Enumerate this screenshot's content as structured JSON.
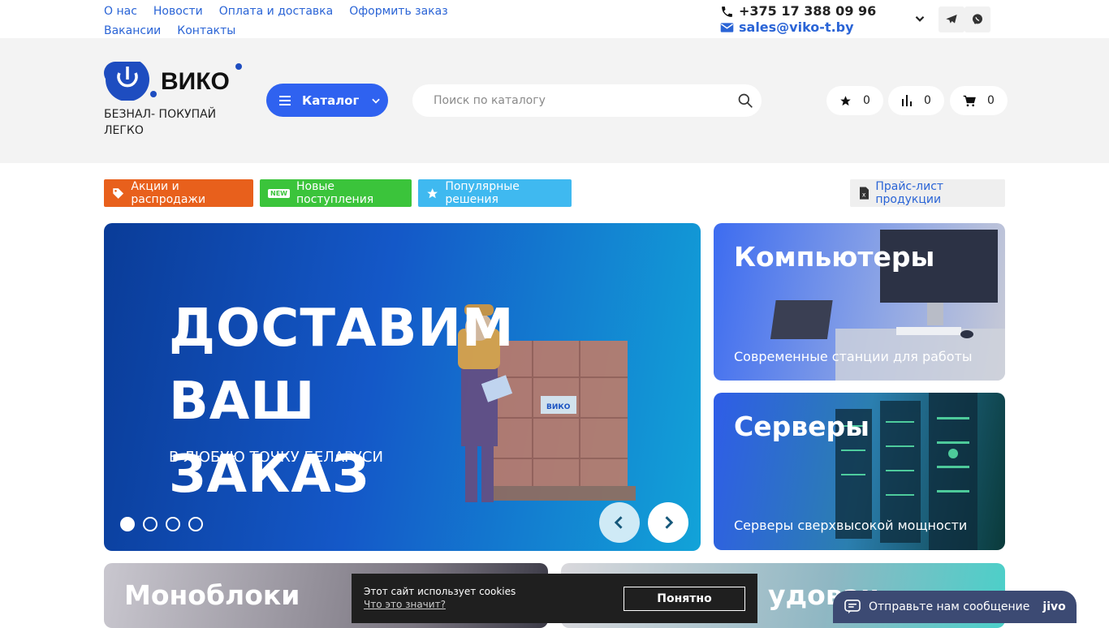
{
  "top_nav": {
    "row1": [
      "О нас",
      "Новости",
      "Оплата и доставка",
      "Оформить заказ"
    ],
    "row2": [
      "Вакансии",
      "Контакты"
    ]
  },
  "contacts": {
    "phone": "+375 17 388 09 96",
    "email": "sales@viko-t.by"
  },
  "logo": {
    "text": "ВИКО"
  },
  "tagline": "БЕЗНАЛ- ПОКУПАЙ ЛЕГКО",
  "catalog_label": "Каталог",
  "search": {
    "placeholder": "Поиск по каталогу"
  },
  "counters": {
    "favorites": "0",
    "compare": "0",
    "cart": "0"
  },
  "tags": {
    "sale": "Акции и распродажи",
    "new": "Новые поступления",
    "new_badge": "NEW",
    "popular": "Популярные решения",
    "price_list": "Прайс-лист продукции"
  },
  "slider": {
    "title_line1": "ДОСТАВИМ ВАШ",
    "title_line2": "ЗАКАЗ",
    "subtitle": "В ЛЮБУЮ ТОЧКУ БЕЛАРУСИ",
    "box_logo": "ВИКО",
    "slides_count": 4,
    "active_slide": 1
  },
  "cards": [
    {
      "title": "Компьютеры",
      "desc": "Современные станции для работы"
    },
    {
      "title": "Серверы",
      "desc": "Серверы сверхвысокой мощности"
    },
    {
      "title": "Моноблоки",
      "desc": ""
    },
    {
      "title": "удован",
      "desc": ""
    }
  ],
  "cookie": {
    "text": "Этот сайт использует cookies",
    "link": "Что это значит?",
    "button": "Понятно"
  },
  "chat": {
    "label": "Отправьте нам сообщение",
    "brand": "jivo"
  },
  "colors": {
    "accent": "#2f62f0",
    "sale": "#e8601c",
    "new": "#3bc43b",
    "popular": "#3fb9f0"
  }
}
